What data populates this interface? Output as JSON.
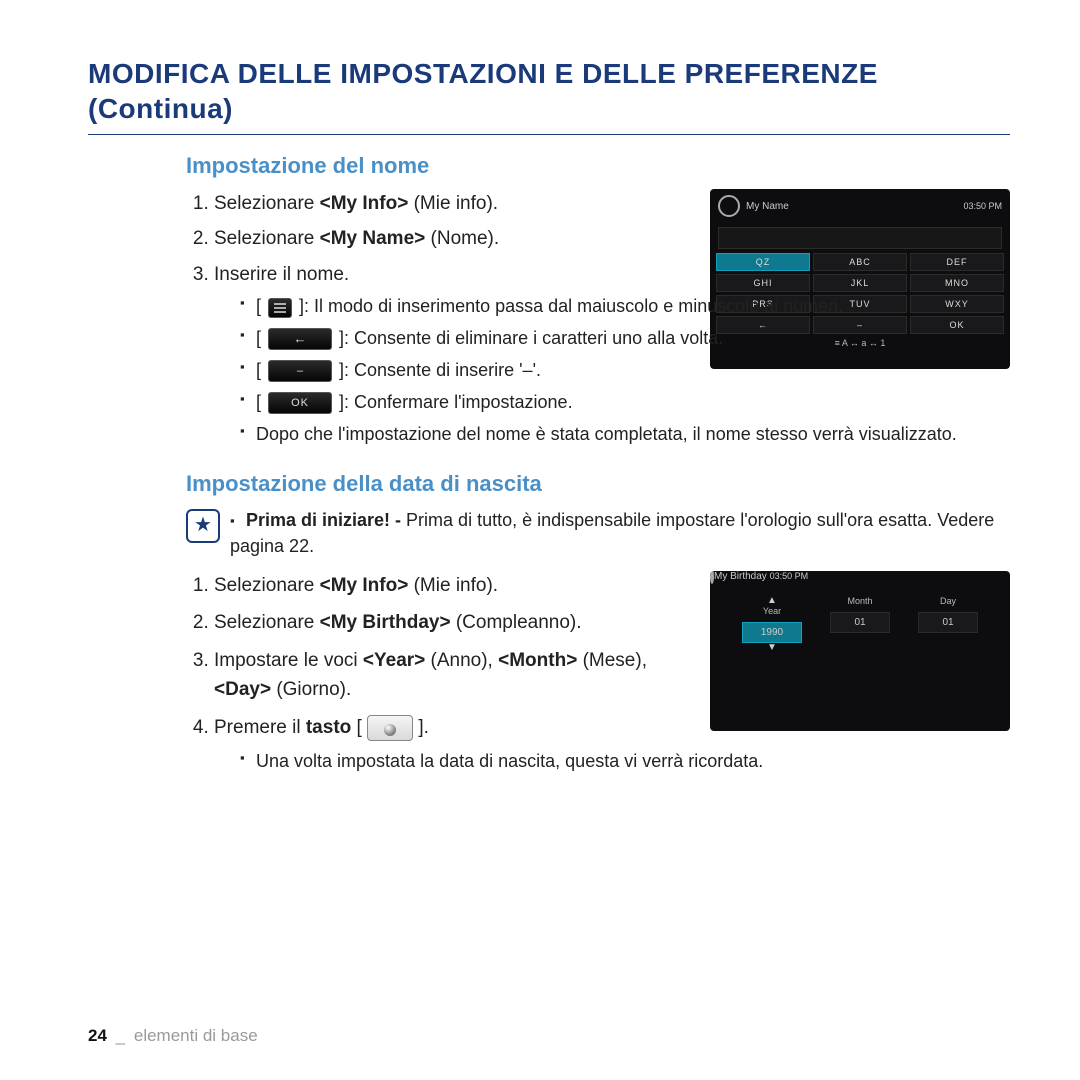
{
  "title": "MODIFICA DELLE IMPOSTAZIONI E DELLE PREFERENZE (Continua)",
  "section1": {
    "heading": "Impostazione del nome",
    "step1_pre": "Selezionare ",
    "step1_bold": "<My Info>",
    "step1_post": " (Mie info).",
    "step2_pre": "Selezionare ",
    "step2_bold": "<My Name>",
    "step2_post": " (Nome).",
    "step3": "Inserire il nome.",
    "sub_menu": "]: Il modo di inserimento passa dal maiuscolo e minuscolo ai numeri.",
    "sub_back": "]: Consente di eliminare i caratteri uno alla volta.",
    "sub_dash": "]: Consente di inserire '–'.",
    "sub_ok": "]: Confermare l'impostazione.",
    "sub_done": "Dopo che l'impostazione del nome è stata completata, il nome stesso verrà visualizzato."
  },
  "shot1": {
    "title": "My Name",
    "clock": "03:50 PM",
    "keys": [
      "QZ",
      "ABC",
      "DEF",
      "GHI",
      "JKL",
      "MNO",
      "PRS",
      "TUV",
      "WXY",
      "←",
      "–",
      "OK"
    ],
    "footer": "≡  A ↔ a  ↔ 1"
  },
  "section2": {
    "heading": "Impostazione della data di nascita",
    "note_lead": "Prima di iniziare! - ",
    "note_rest": "Prima di tutto, è indispensabile impostare l'orologio sull'ora esatta. Vedere pagina 22.",
    "step1_pre": "Selezionare ",
    "step1_bold": "<My Info>",
    "step1_post": " (Mie info).",
    "step2_pre": "Selezionare ",
    "step2_bold": "<My Birthday>",
    "step2_post": " (Compleanno).",
    "step3_pre": "Impostare le voci ",
    "step3_b1": "<Year>",
    "step3_m1": " (Anno), ",
    "step3_b2": "<Month>",
    "step3_m2": " (Mese), ",
    "step3_b3": "<Day>",
    "step3_m3": " (Giorno).",
    "step4_pre": "Premere il ",
    "step4_bold": "tasto",
    "step4_post": " [",
    "step4_close": "].",
    "sub_done": "Una volta impostata la data di nascita, questa vi verrà ricordata."
  },
  "shot2": {
    "title": "My Birthday",
    "clock": "03:50 PM",
    "labels": {
      "year": "Year",
      "month": "Month",
      "day": "Day"
    },
    "values": {
      "year": "1990",
      "month": "01",
      "day": "01"
    }
  },
  "footer": {
    "page": "24",
    "section": "elementi di base"
  },
  "icon_text": {
    "dash": "–",
    "ok": "OK"
  }
}
